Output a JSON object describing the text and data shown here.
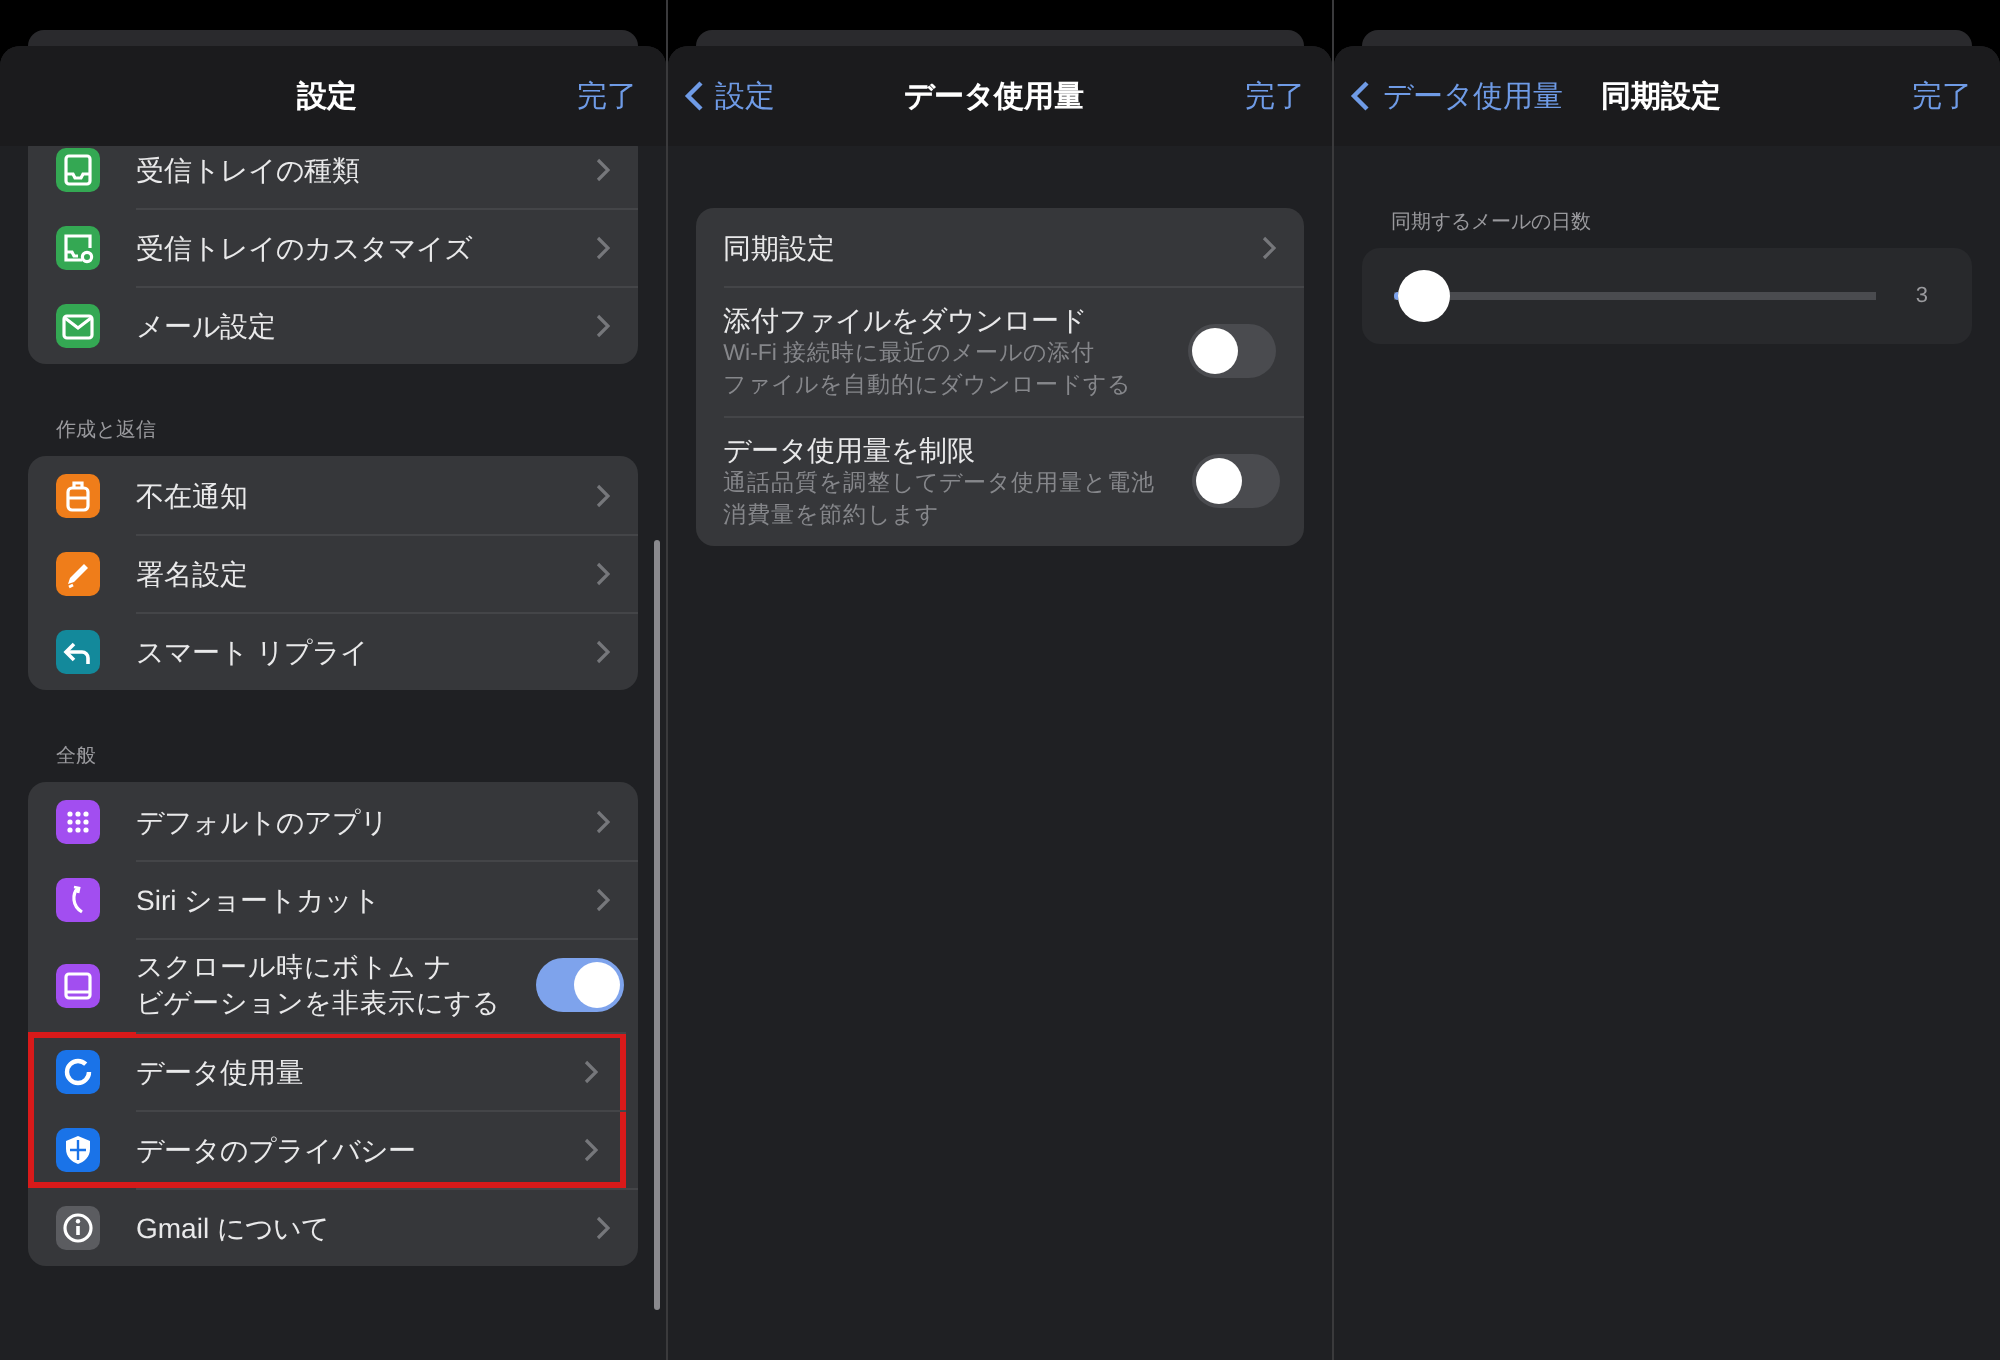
{
  "panels": [
    {
      "header": {
        "title": "設定",
        "done": "完了"
      },
      "scrollable": true,
      "sections": [
        {
          "rows": [
            {
              "kind": "link",
              "label": "受信トレイの種類",
              "color": "#34a853",
              "highlighted": false
            },
            {
              "kind": "link",
              "label": "受信トレイのカスタマイズ",
              "color": "#34a853",
              "highlighted": false
            },
            {
              "kind": "link",
              "label": "メール設定",
              "color": "#34a853",
              "highlighted": false
            }
          ]
        },
        {
          "label": "作成と返信",
          "rows": [
            {
              "kind": "link",
              "label": "不在通知",
              "color": "#ef7d1a",
              "highlighted": false
            },
            {
              "kind": "link",
              "label": "署名設定",
              "color": "#ef7d1a",
              "highlighted": false
            },
            {
              "kind": "link",
              "label": "スマート リプライ",
              "color": "#13899b",
              "highlighted": false
            }
          ]
        },
        {
          "label": "全般",
          "rows": [
            {
              "kind": "link",
              "label": "デフォルトのアプリ",
              "color": "#a24ef0",
              "highlighted": false
            },
            {
              "kind": "link",
              "label": "Siri ショートカット",
              "color": "#a24ef0",
              "highlighted": false
            },
            {
              "kind": "toggle",
              "label_lines": [
                "スクロール時にボトム ナ",
                "ビゲーションを非表示にする"
              ],
              "color": "#a24ef0",
              "on": true,
              "highlighted": false
            },
            {
              "kind": "link",
              "label": "データ使用量",
              "color": "#1a73e8",
              "highlighted": true
            },
            {
              "kind": "link",
              "label": "データのプライバシー",
              "color": "#1a73e8",
              "highlighted": true
            },
            {
              "kind": "link",
              "label": "Gmail について",
              "color": "#5b5c60",
              "highlighted": false
            }
          ]
        }
      ]
    },
    {
      "header": {
        "back": "設定",
        "title": "データ使用量",
        "done": "完了"
      },
      "scrollable": false,
      "sections": [
        {
          "rows": [
            {
              "kind": "link",
              "label": "同期設定"
            },
            {
              "kind": "toggle",
              "label": "添付ファイルをダウンロード",
              "detail_lines": [
                "Wi-Fi 接続時に最近のメールの添付",
                "ファイルを自動的にダウンロードする"
              ],
              "on": false
            },
            {
              "kind": "toggle",
              "label": "データ使用量を制限",
              "detail_lines": [
                "通話品質を調整してデータ使用量と電池",
                "消費量を節約します"
              ],
              "on": false
            }
          ]
        }
      ]
    },
    {
      "header": {
        "back": "データ使用量",
        "title": "同期設定",
        "done": "完了"
      },
      "scrollable": false,
      "sections": [
        {
          "label": "同期するメールの日数",
          "rows": [
            {
              "kind": "slider",
              "level": 0.06,
              "reading": "3"
            }
          ]
        }
      ]
    }
  ]
}
